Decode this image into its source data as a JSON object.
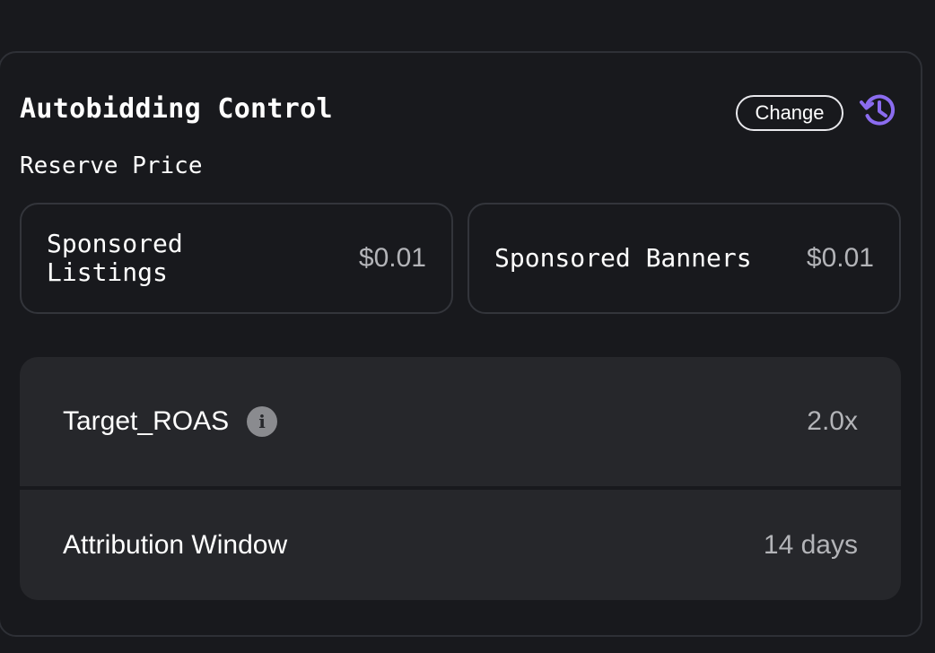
{
  "card": {
    "title": "Autobidding Control",
    "change_label": "Change",
    "history_icon": "history-icon",
    "accent_color": "#8b6cf0"
  },
  "reserve_price": {
    "heading": "Reserve Price",
    "items": [
      {
        "name": "Sponsored\nListings",
        "value": "$0.01"
      },
      {
        "name": "Sponsored Banners",
        "value": "$0.01"
      }
    ]
  },
  "settings": [
    {
      "label": "Target_ROAS",
      "info_icon": "i",
      "value": "2.0x"
    },
    {
      "label": "Attribution Window",
      "value": "14 days"
    }
  ]
}
